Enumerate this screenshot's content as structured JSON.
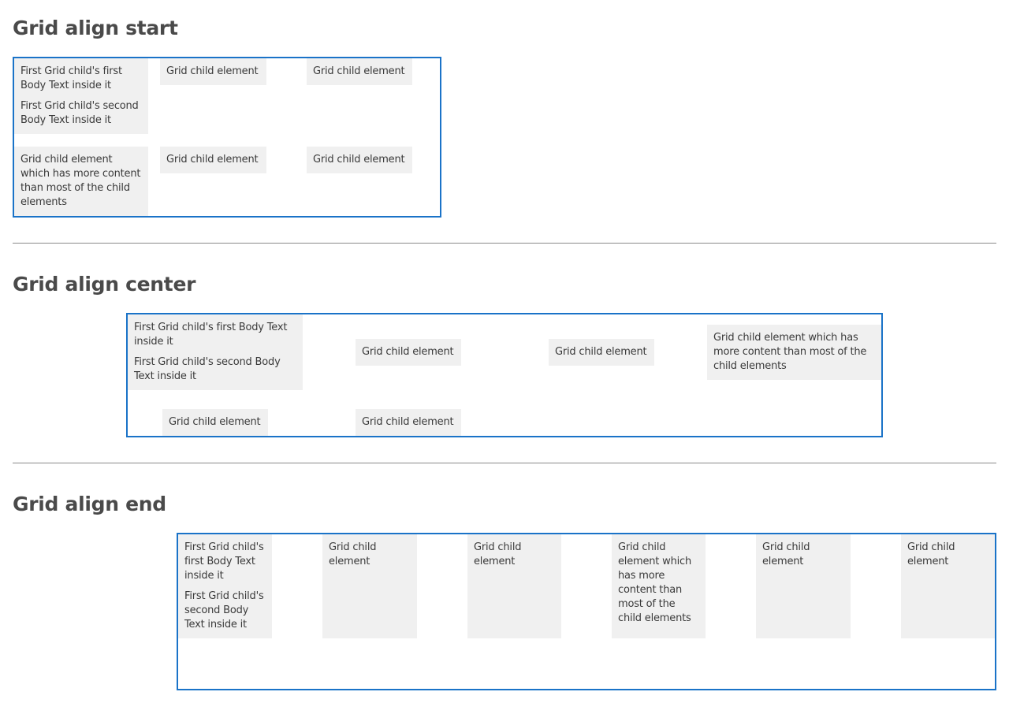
{
  "sections": {
    "start": {
      "title": "Grid align start",
      "first_child": {
        "text1": "First Grid child's first Body Text inside it",
        "text2": "First Grid child's second Body Text inside it"
      },
      "cells": [
        "Grid child element",
        "Grid child element",
        "Grid child element which has more content than most of the child elements",
        "Grid child element",
        "Grid child element"
      ]
    },
    "center": {
      "title": "Grid align center",
      "first_child": {
        "text1": "First Grid child's first Body Text inside it",
        "text2": "First Grid child's second Body Text inside it"
      },
      "cells": [
        "Grid child element",
        "Grid child element",
        "Grid child element which has more content than most of the child elements",
        "Grid child element",
        "Grid child element"
      ]
    },
    "end": {
      "title": "Grid align end",
      "first_child": {
        "text1": "First Grid child's first Body Text inside it",
        "text2": "First Grid child's second Body Text inside it"
      },
      "cells": [
        "Grid child element",
        "Grid child element",
        "Grid child element which has more content than most of the child elements",
        "Grid child element",
        "Grid child element"
      ]
    }
  },
  "colors": {
    "grid_border": "#1a73c8",
    "cell_background": "#f0f0f0",
    "divider": "#8a8a8a",
    "heading_text": "#4a4a4a"
  }
}
